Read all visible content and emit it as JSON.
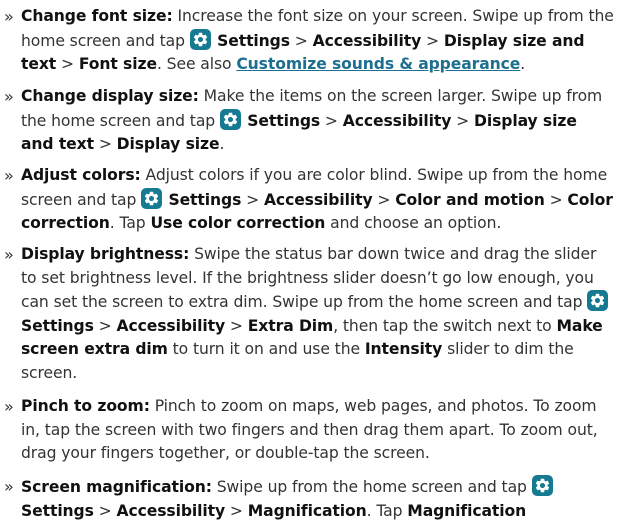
{
  "bullet": "»",
  "colors": {
    "text": "#333333",
    "bold": "#111111",
    "link": "#1e6f8f",
    "settings_icon_bg": "#167b92"
  },
  "icons": {
    "settings": "gear-icon"
  },
  "items": [
    {
      "heading": "Change font size:",
      "t1": " Increase the font size on your screen. Swipe up from the home screen and tap ",
      "b_settings": " Settings",
      "sep1": " > ",
      "b1": "Accessibility",
      "sep2": " > ",
      "b2": "Display size and text",
      "sep3": " > ",
      "b3": "Font size",
      "t2": ". See also ",
      "link": "Customize sounds & appearance",
      "t3": "."
    },
    {
      "heading": "Change display size:",
      "t1": " Make the items on the screen larger. Swipe up from the home screen and tap ",
      "b_settings": " Settings",
      "sep1": " > ",
      "b1": "Accessibility",
      "sep2": " > ",
      "b2": "Display size and text",
      "sep3": " > ",
      "b3": "Display size",
      "t2": "."
    },
    {
      "heading": "Adjust colors:",
      "t1": " Adjust colors if you are color blind. Swipe up from the home screen and tap ",
      "b_settings": " Settings",
      "sep1": " > ",
      "b1": "Accessibility",
      "sep2": " > ",
      "b2": "Color and motion",
      "sep3": " > ",
      "b3": "Color correction",
      "t2": ". Tap ",
      "b4": "Use color correction",
      "t3": " and choose an option."
    },
    {
      "heading": "Display brightness:",
      "t1": " Swipe the status bar down twice and drag the slider to set brightness level. If the brightness slider doesn’t go low enough, you can set the screen to extra dim. Swipe up from the home screen and tap ",
      "b_settings": " Settings",
      "sep1": " > ",
      "b1": "Accessibility",
      "sep2": " > ",
      "b2": "Extra Dim",
      "t2": ", then tap the switch next to ",
      "b3": "Make screen extra dim",
      "t3": " to turn it on and use the ",
      "b4": "Intensity",
      "t4": " slider to dim the screen."
    },
    {
      "heading": "Pinch to zoom:",
      "t1": " Pinch to zoom on maps, web pages, and photos. To zoom in, tap the screen with two fingers and then drag them apart. To zoom out, drag your fingers together, or double-tap the screen."
    },
    {
      "heading": "Screen magnification:",
      "t1": " Swipe up from the home screen and tap ",
      "b_settings": " Settings",
      "sep1": " > ",
      "b1": "Accessibility",
      "sep2": " > ",
      "b2": "Magnification",
      "t2": ". Tap ",
      "b3": "Magnification"
    }
  ]
}
